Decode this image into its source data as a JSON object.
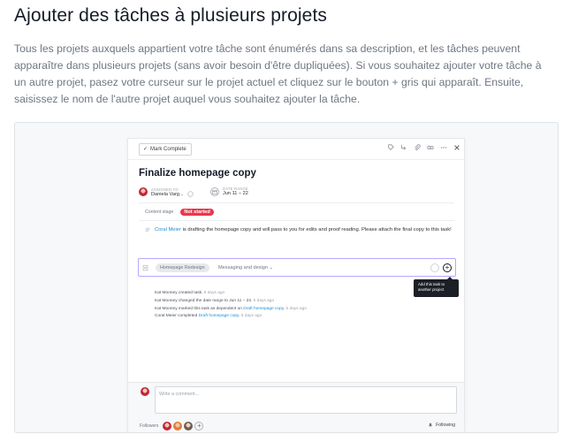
{
  "article": {
    "title": "Ajouter des tâches à plusieurs projets",
    "body": "Tous les projets auxquels appartient votre tâche sont énumérés dans sa description, et les tâches peuvent apparaître dans plusieurs projets (sans avoir besoin d'être dupliquées). Si vous souhaitez ajouter votre tâche à un autre projet, pasez votre curseur sur le projet actuel et cliquez sur le bouton + gris qui apparaît. Ensuite, saisissez le nom de l'autre projet auquel vous souhaitez ajouter la tâche."
  },
  "task": {
    "mark_complete": "Mark Complete",
    "toolbar_icons": [
      "tag-icon",
      "subtask-icon",
      "attach-icon",
      "link-icon",
      "more-icon",
      "close-icon"
    ],
    "title": "Finalize homepage copy",
    "assignee_label": "ASSIGNED TO",
    "assignee_name": "Daniela Varg...",
    "date_label": "DATE RANGE",
    "date_value": "Jun 11 – 22",
    "stage_label": "Content stage",
    "stage_value": "Not started",
    "description_link": "Coral Meier",
    "description_text": " is drafting the homepage copy and will pass to you for edits and proof reading. Please attach the final copy to this task!",
    "project_pill": "Homepage Redesign",
    "project_section": "Messaging and design ⌄",
    "tooltip_text": "Add this task to another project",
    "activity": [
      {
        "text": "Kat Mooney created task.",
        "time": "6 days ago",
        "link": ""
      },
      {
        "text": "Kat Mooney changed the date range to Jun 11 – 22.",
        "time": "5 days ago",
        "link": ""
      },
      {
        "text": "Kat Mooney marked this task as dependent on ",
        "link": "Draft homepage copy",
        "time": "5 days ago"
      },
      {
        "text": "Coral Meier completed ",
        "link": "Draft homepage copy",
        "time": "5 days ago"
      }
    ],
    "comment_placeholder": "Write a comment...",
    "followers_label": "Followers",
    "following_label": "Following"
  },
  "colors": {
    "accent_link": "#1f8dd6",
    "badge_red": "#e8384f",
    "focus_border": "#b8a6ff"
  }
}
